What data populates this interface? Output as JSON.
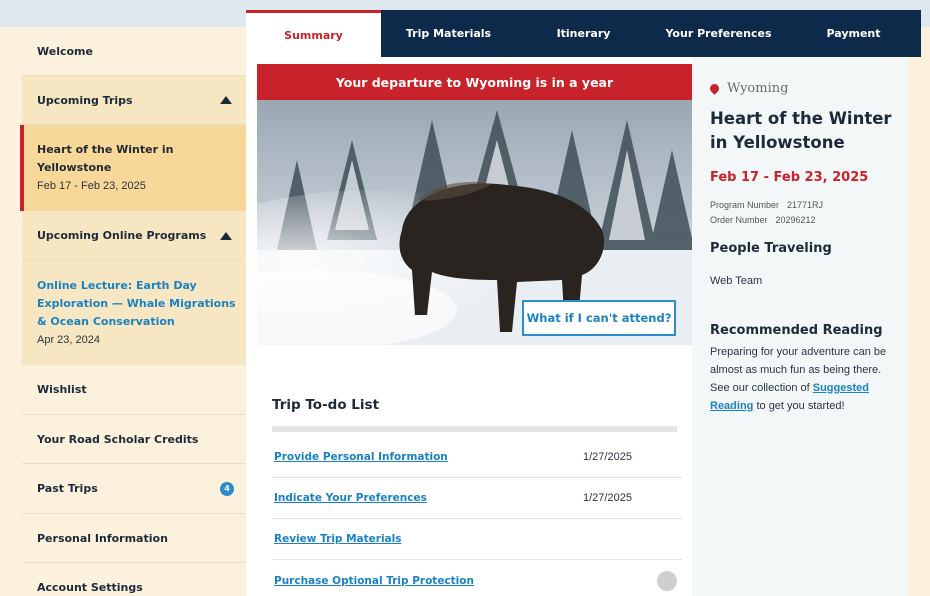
{
  "tabs": [
    "Summary",
    "Trip Materials",
    "Itinerary",
    "Your Preferences",
    "Payment"
  ],
  "sidebar": {
    "welcome": "Welcome",
    "upcoming_trips": "Upcoming Trips",
    "active_trip": {
      "title": "Heart of the Winter in Yellowstone",
      "dates": "Feb 17 - Feb 23, 2025"
    },
    "upcoming_online": "Upcoming Online Programs",
    "online_program": {
      "title": "Online Lecture: Earth Day Exploration — Whale Migrations & Ocean Conservation",
      "dates": "Apr 23, 2024"
    },
    "wishlist": "Wishlist",
    "credits": "Your Road Scholar Credits",
    "past_trips": "Past Trips",
    "past_trips_count": "4",
    "personal_info": "Personal Information",
    "account_settings": "Account Settings"
  },
  "main": {
    "banner": "Your departure to Wyoming is in a year",
    "attend_button": "What if I can't attend?",
    "todo_title": "Trip To-do List",
    "todo": [
      {
        "label": "Provide Personal Information",
        "date": "1/27/2025"
      },
      {
        "label": "Indicate Your Preferences",
        "date": "1/27/2025"
      },
      {
        "label": "Review Trip Materials",
        "date": ""
      },
      {
        "label": "Purchase Optional Trip Protection",
        "date": ""
      }
    ]
  },
  "right": {
    "location": "Wyoming",
    "trip_title": "Heart of the Winter in Yellowstone",
    "dates": "Feb 17 - Feb 23, 2025",
    "program_number_label": "Program Number",
    "program_number": "21771RJ",
    "order_number_label": "Order Number",
    "order_number": "20296212",
    "people_heading": "People Traveling",
    "people": "Web Team",
    "reading_heading": "Recommended Reading",
    "reading_text_1": "Preparing for your adventure can be almost as much fun as being there. See our collection of ",
    "reading_link": "Suggested Reading",
    "reading_text_2": " to get you started!"
  },
  "colors": {
    "brand_red": "#c8222b",
    "navy": "#0e2a4a",
    "link_blue": "#1a82c2",
    "sidebar_bg": "#fbf1dd"
  },
  "icons": [
    "caret-up-icon",
    "location-pin-icon",
    "status-circle-icon"
  ]
}
